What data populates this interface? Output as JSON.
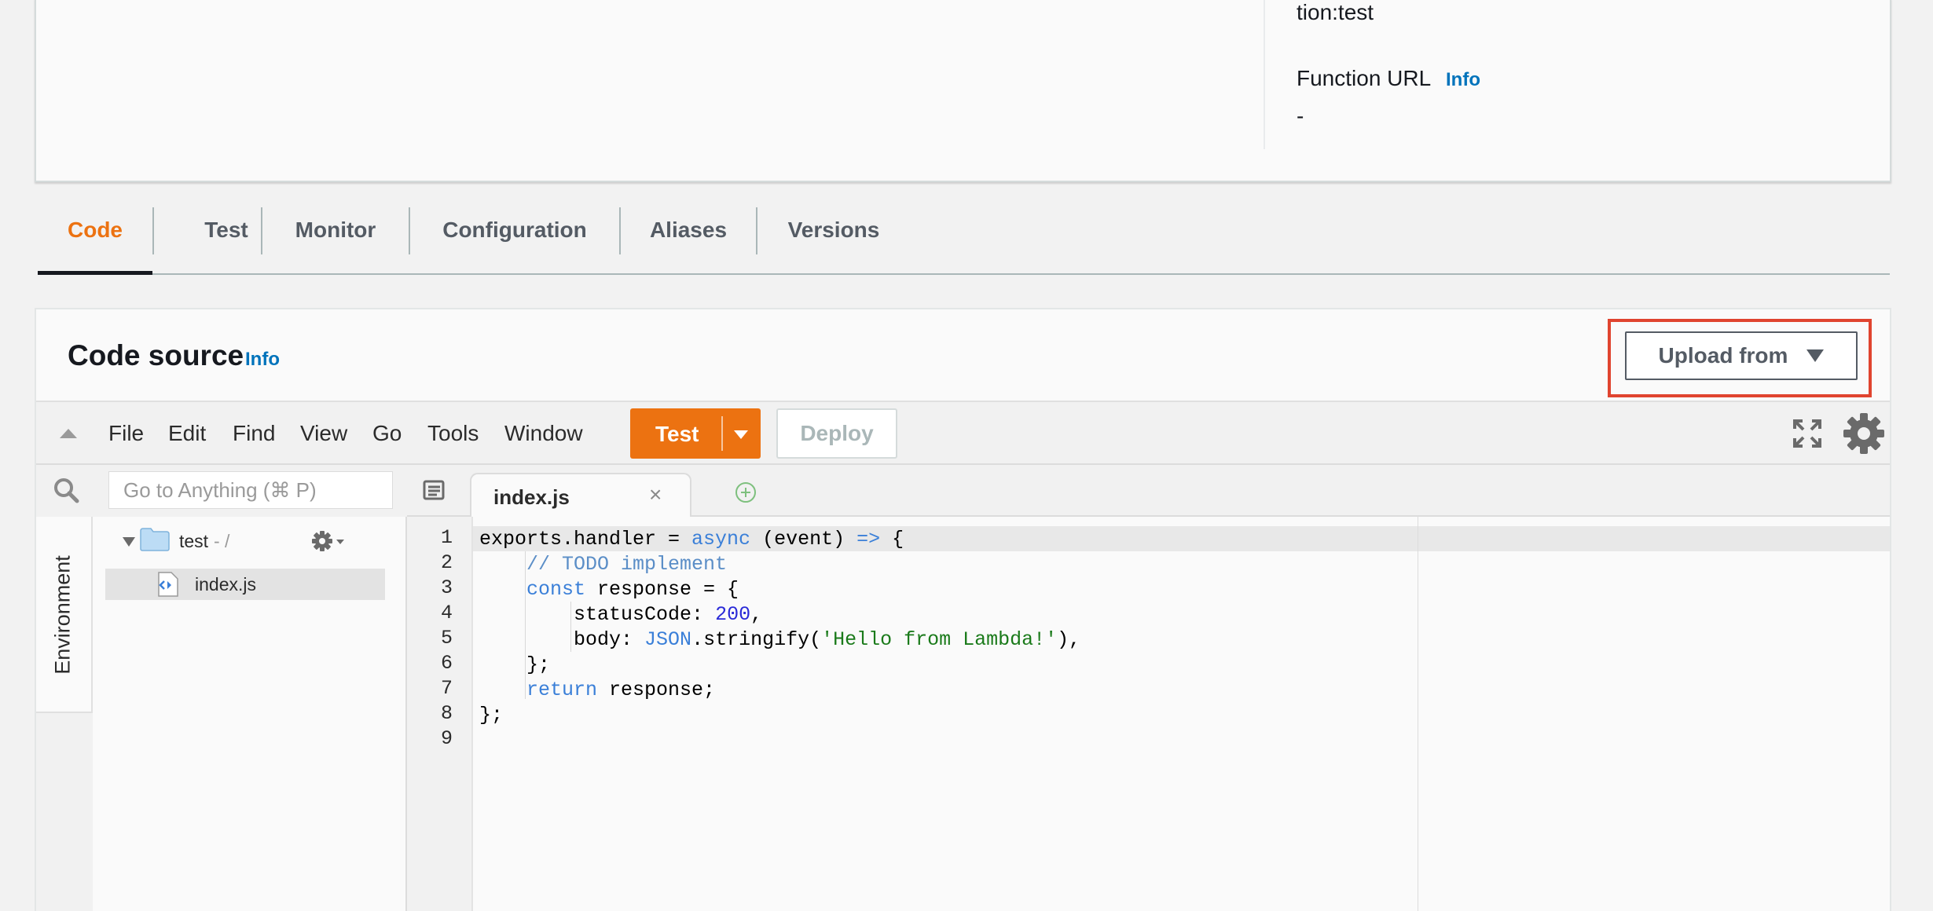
{
  "overview": {
    "arn_tail": "tion:test",
    "function_url_label": "Function URL",
    "function_url_info": "Info",
    "function_url_value": "-"
  },
  "tabs": [
    {
      "label": "Code",
      "active": true
    },
    {
      "label": "Test",
      "active": false
    },
    {
      "label": "Monitor",
      "active": false
    },
    {
      "label": "Configuration",
      "active": false
    },
    {
      "label": "Aliases",
      "active": false
    },
    {
      "label": "Versions",
      "active": false
    }
  ],
  "code_source": {
    "title": "Code source",
    "info": "Info",
    "upload_button": "Upload from"
  },
  "ide": {
    "menu": [
      "File",
      "Edit",
      "Find",
      "View",
      "Go",
      "Tools",
      "Window"
    ],
    "test_button": "Test",
    "deploy_button": "Deploy",
    "search_placeholder": "Go to Anything (⌘ P)",
    "environment_tab": "Environment",
    "tree": {
      "folder_name": "test",
      "folder_path": "- /",
      "file_name": "index.js"
    },
    "open_tab": "index.js",
    "close_glyph": "×"
  },
  "editor": {
    "line_numbers": [
      "1",
      "2",
      "3",
      "4",
      "5",
      "6",
      "7",
      "8",
      "9"
    ],
    "lines": [
      "exports.handler = async (event) => {",
      "    // TODO implement",
      "    const response = {",
      "        statusCode: 200,",
      "        body: JSON.stringify('Hello from Lambda!'),",
      "    };",
      "    return response;",
      "};",
      ""
    ]
  },
  "colors": {
    "accent_orange": "#ec7211",
    "link_blue": "#0073bb",
    "highlight_red": "#e0442f"
  }
}
